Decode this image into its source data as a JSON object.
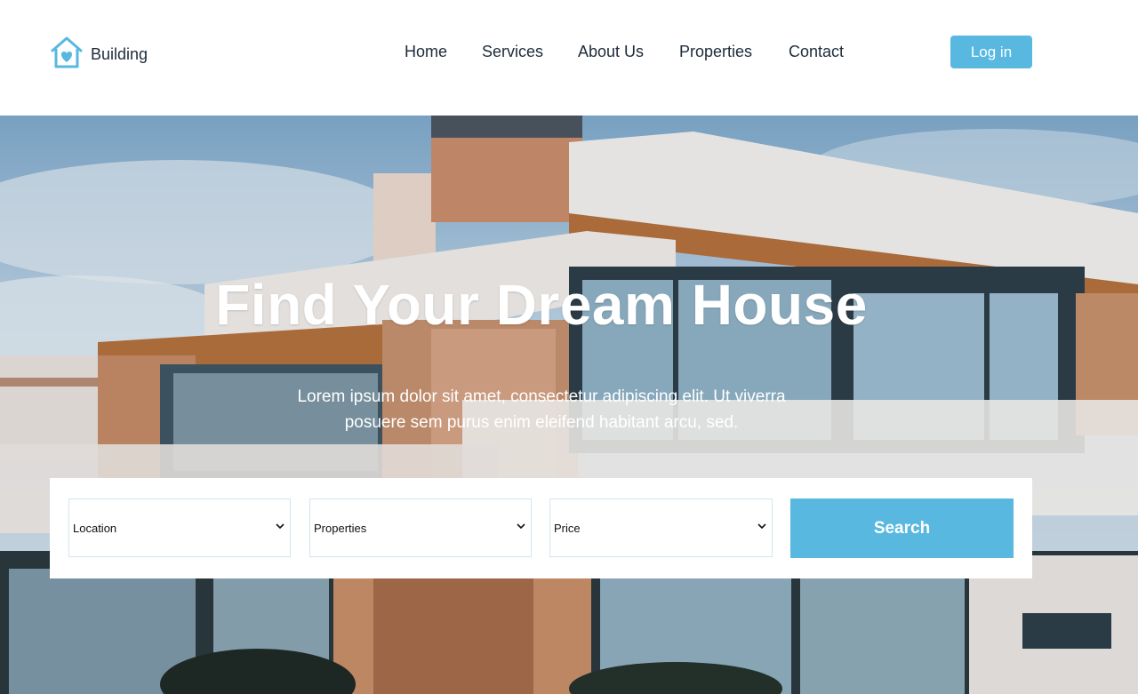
{
  "brand": {
    "name": "Building",
    "icon": "house-heart-icon",
    "color": "#58b8e0"
  },
  "nav": {
    "items": [
      {
        "label": "Home"
      },
      {
        "label": "Services"
      },
      {
        "label": "About Us"
      },
      {
        "label": "Properties"
      },
      {
        "label": "Contact"
      }
    ],
    "login_label": "Log in"
  },
  "hero": {
    "title": "Find Your Dream House",
    "subtitle": "Lorem ipsum dolor sit amet, consectetur adipiscing elit. Ut viverra posuere sem purus enim eleifend habitant arcu, sed."
  },
  "search": {
    "location": "Location",
    "properties": "Properties",
    "price": "Price",
    "button_label": "Search"
  },
  "colors": {
    "accent": "#58b8e0",
    "text_dark": "#1d2b3a",
    "white": "#ffffff"
  }
}
